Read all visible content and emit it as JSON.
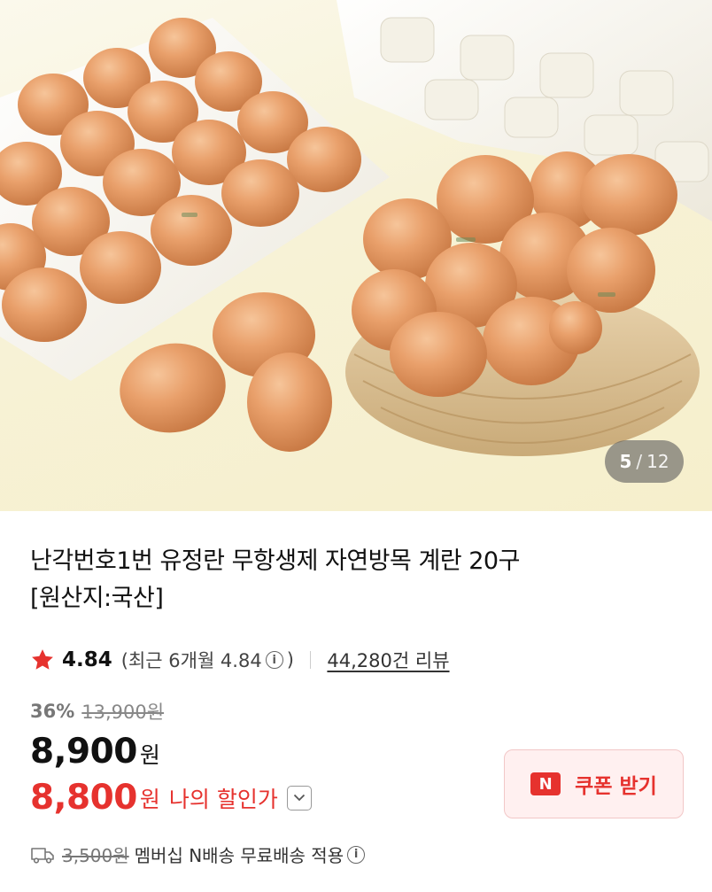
{
  "gallery": {
    "current": "5",
    "separator": "/",
    "total": "12"
  },
  "product": {
    "title_line1": "난각번호1번 유정란 무항생제 자연방목 계란 20구",
    "title_line2": "[원산지:국산]"
  },
  "rating": {
    "score": "4.84",
    "recent": "(최근 6개월 4.84",
    "recent_close": ")",
    "reviews": "44,280건 리뷰"
  },
  "pricing": {
    "discount_rate": "36%",
    "original_price": "13,900원",
    "price": "8,900",
    "currency": "원",
    "my_price": "8,800",
    "my_currency": "원",
    "my_price_label": "나의 할인가"
  },
  "coupon": {
    "logo": "N",
    "label": "쿠폰 받기"
  },
  "shipping": {
    "fee": "3,500원",
    "text": "멤버십 N배송 무료배송 적용"
  },
  "colors": {
    "accent_red": "#e6322e",
    "star": "#e6322e"
  },
  "icons": [
    "star-icon",
    "info-icon",
    "chevron-down-icon",
    "truck-icon",
    "n-logo-icon"
  ]
}
